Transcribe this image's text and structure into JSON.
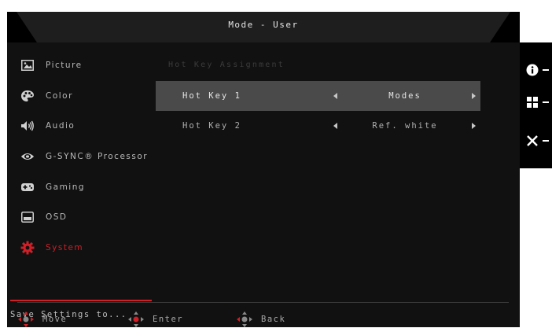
{
  "title": "Mode - User",
  "sidebar": {
    "items": [
      {
        "label": "Picture",
        "icon": "picture-icon"
      },
      {
        "label": "Color",
        "icon": "palette-icon"
      },
      {
        "label": "Audio",
        "icon": "speaker-icon"
      },
      {
        "label": "G-SYNC® Processor",
        "icon": "nvidia-eye-icon"
      },
      {
        "label": "Gaming",
        "icon": "gamepad-icon"
      },
      {
        "label": "OSD",
        "icon": "osd-window-icon"
      },
      {
        "label": "System",
        "icon": "gear-icon",
        "active": true
      }
    ],
    "save_settings": "Save Settings to..."
  },
  "content": {
    "section_header": "Hot Key Assignment",
    "rows": [
      {
        "label": "Hot Key 1",
        "value": "Modes",
        "selected": true
      },
      {
        "label": "Hot Key 2",
        "value": "Ref. white",
        "selected": false
      }
    ]
  },
  "footer": {
    "move": "Move",
    "enter": "Enter",
    "back": "Back"
  },
  "side_panel": {
    "icons": [
      "info-icon",
      "menu-grid-icon",
      "close-icon"
    ]
  },
  "colors": {
    "accent": "#d01f26",
    "background": "#111111",
    "selected_row": "#4a4a4a"
  }
}
